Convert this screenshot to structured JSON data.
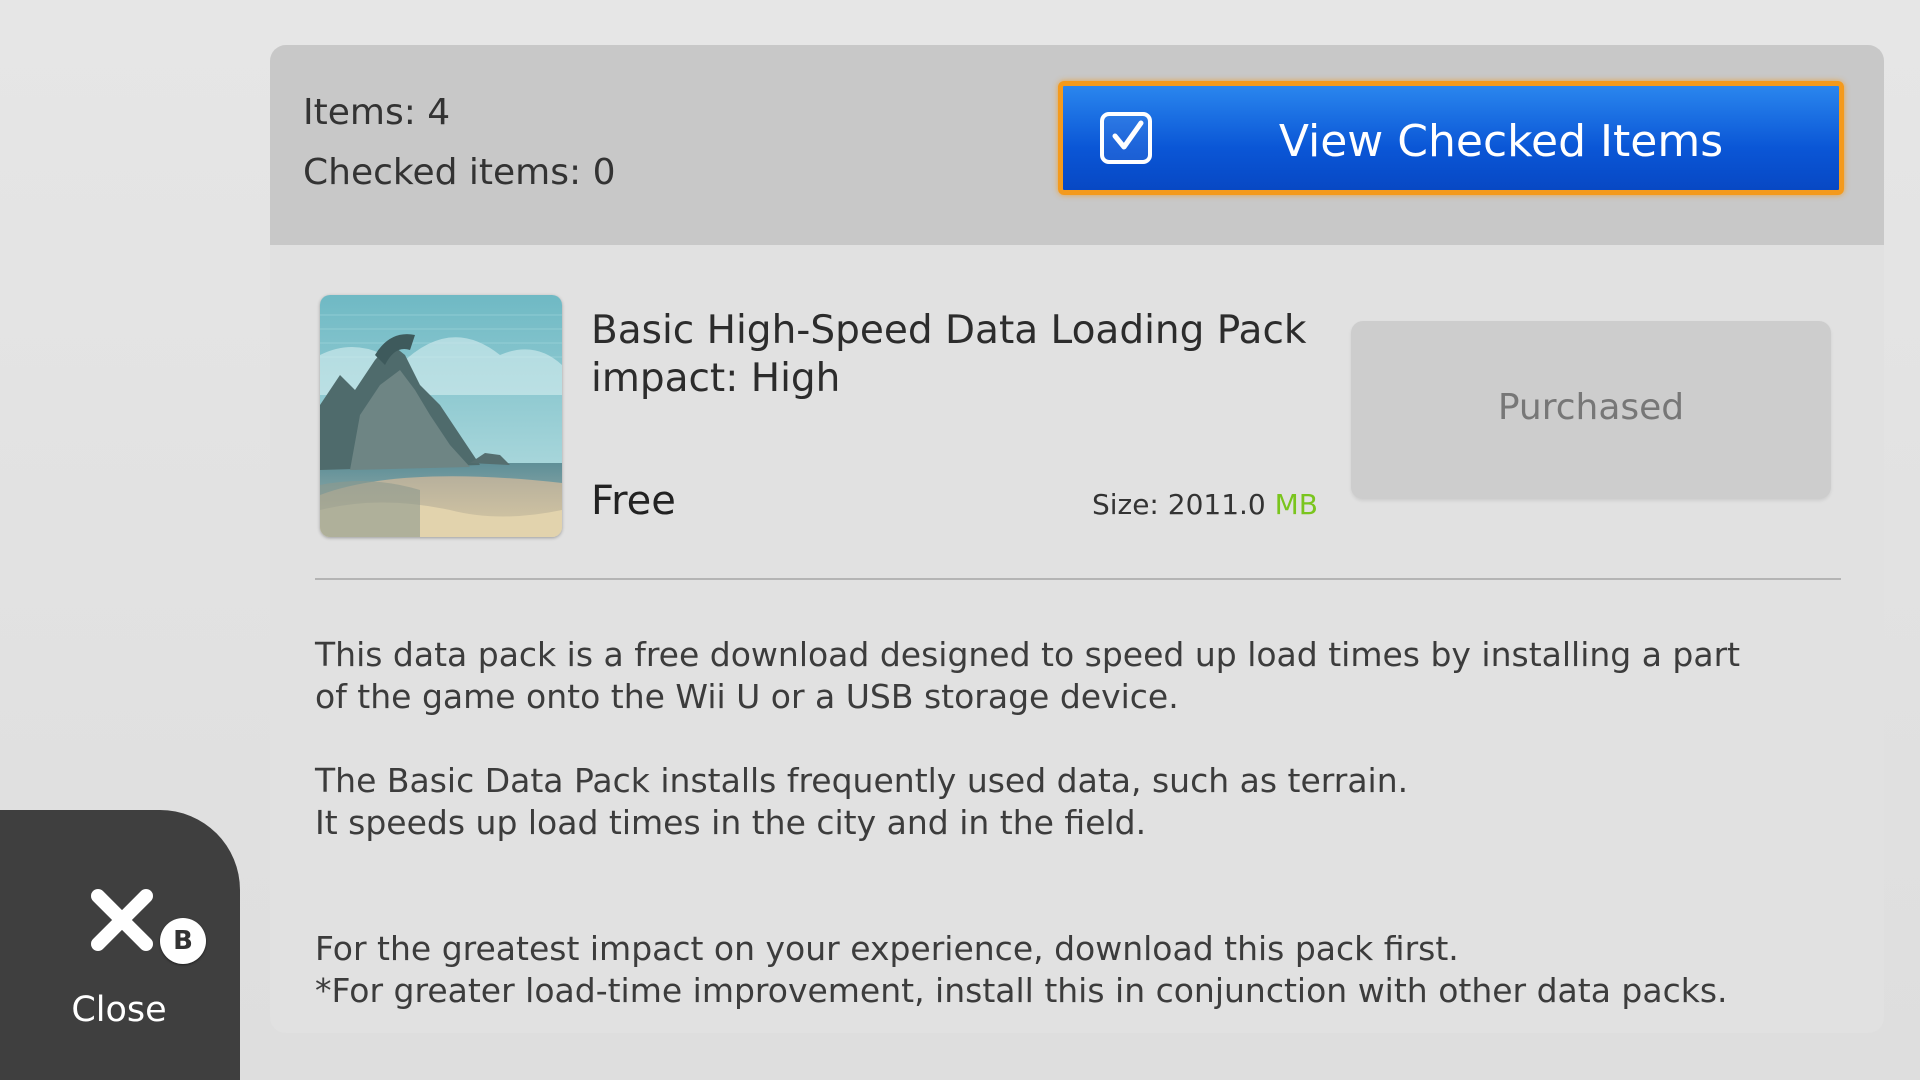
{
  "header": {
    "items_count": "Items: 4",
    "checked_count": "Checked items: 0",
    "view_checked_label": "View Checked Items"
  },
  "item": {
    "title_line1": "Basic High-Speed Data Loading Pack",
    "title_line2": "impact: High",
    "price": "Free",
    "size_label": "Size: 2011.0 ",
    "size_unit": "MB",
    "status_button_label": "Purchased"
  },
  "description": {
    "para1_line1": "This data pack is a free download designed to speed up load times by installing a part",
    "para1_line2": "of the game onto the Wii U or a USB storage device.",
    "para2_line1": "The Basic Data Pack installs frequently used data, such as terrain.",
    "para2_line2": "It speeds up load times in the city and in the field.",
    "para3_line1": "For the greatest impact on your experience, download this pack first.",
    "para3_line2": "*For greater load-time improvement, install this in conjunction with other data packs."
  },
  "close": {
    "label": "Close",
    "button_hint": "B"
  },
  "icons": {
    "view_checked": "checkbox-checked-icon",
    "close": "close-x-icon",
    "b_button": "b-button-icon"
  },
  "colors": {
    "accent_blue": "#0a56d6",
    "focus_orange": "#f49a1c",
    "size_unit_green": "#7ac51e"
  }
}
